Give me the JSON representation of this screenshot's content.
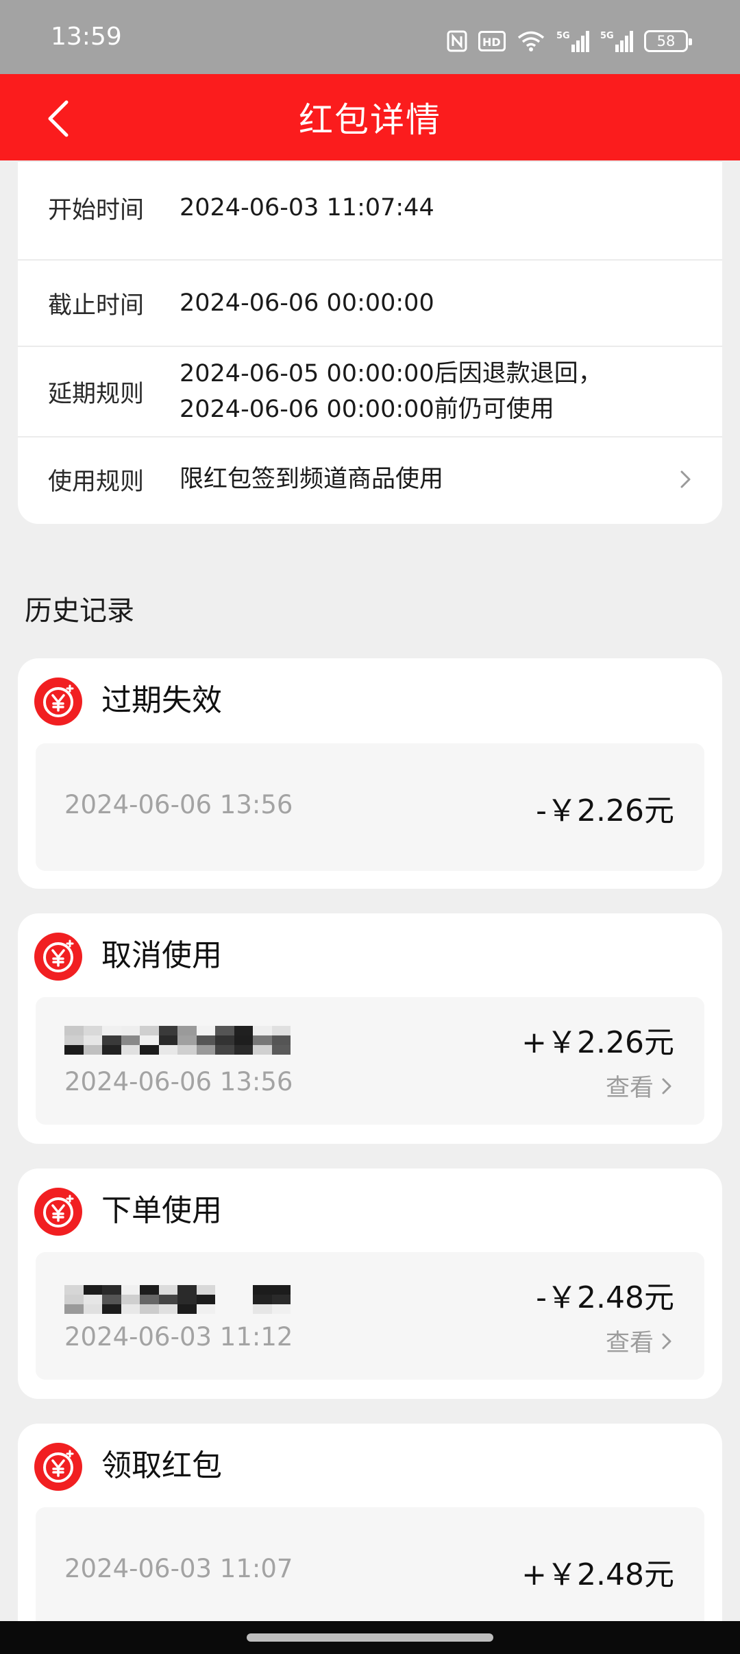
{
  "status_bar": {
    "time": "13:59",
    "battery": "58",
    "icons": [
      "nfc-icon",
      "hd-icon",
      "wifi-icon",
      "signal-5g-icon",
      "signal-5g-icon",
      "battery-icon"
    ]
  },
  "header": {
    "title": "红包详情",
    "back_icon": "chevron-left-icon"
  },
  "info_rows": [
    {
      "label": "开始时间",
      "value": "2024-06-03 11:07:44"
    },
    {
      "label": "截止时间",
      "value": "2024-06-06 00:00:00"
    },
    {
      "label": "延期规则",
      "value_line1": "2024-06-05 00:00:00后因退款退回，",
      "value_line2": "2024-06-06 00:00:00前仍可使用"
    },
    {
      "label": "使用规则",
      "value": "限红包签到频道商品使用"
    }
  ],
  "history": {
    "title": "历史记录",
    "records": [
      {
        "title": "过期失效",
        "time": "2024-06-06 13:56",
        "amount": "-￥2.26元"
      },
      {
        "title": "取消使用",
        "time": "2024-06-06 13:56",
        "amount": "+￥2.26元",
        "link": "查看"
      },
      {
        "title": "下单使用",
        "time": "2024-06-03 11:12",
        "amount": "-￥2.48元",
        "link": "查看"
      },
      {
        "title": "领取红包",
        "time": "2024-06-03 11:07",
        "amount": "+￥2.48元"
      }
    ]
  },
  "colors": {
    "brand_red": "#fb1c1d",
    "status_bar": "#a3a3a3",
    "background": "#efefef",
    "muted_text": "#a3a3a3"
  }
}
